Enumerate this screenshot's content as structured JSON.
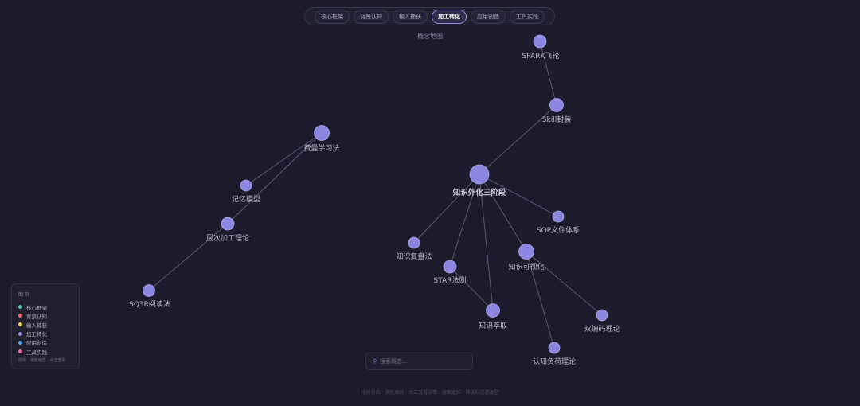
{
  "tabs": [
    {
      "label": "核心框架",
      "active": false
    },
    {
      "label": "背景认知",
      "active": false
    },
    {
      "label": "输入捕获",
      "active": false
    },
    {
      "label": "加工转化",
      "active": true
    },
    {
      "label": "应用创造",
      "active": false
    },
    {
      "label": "工具实践",
      "active": false
    }
  ],
  "page_title": "概念地图",
  "graph": {
    "node_color": "#8b86e0",
    "edge_color": "#5a5a70",
    "nodes": [
      {
        "id": "spark",
        "label": "SPARK飞轮"
      },
      {
        "id": "skill",
        "label": "Skill封装"
      },
      {
        "id": "feynman",
        "label": "费曼学习法"
      },
      {
        "id": "main",
        "label": "知识外化三阶段"
      },
      {
        "id": "memory",
        "label": "记忆模型"
      },
      {
        "id": "sop",
        "label": "SOP文件体系"
      },
      {
        "id": "levels",
        "label": "层次加工理论"
      },
      {
        "id": "review",
        "label": "知识复盘法"
      },
      {
        "id": "visual",
        "label": "知识可视化"
      },
      {
        "id": "star",
        "label": "STAR法则"
      },
      {
        "id": "sq3r",
        "label": "SQ3R阅读法"
      },
      {
        "id": "extract",
        "label": "知识萃取"
      },
      {
        "id": "dual",
        "label": "双编码理论"
      },
      {
        "id": "cognitive",
        "label": "认知负荷理论"
      }
    ],
    "edges": [
      [
        "spark",
        "skill"
      ],
      [
        "skill",
        "main"
      ],
      [
        "main",
        "sop"
      ],
      [
        "main",
        "review"
      ],
      [
        "main",
        "star"
      ],
      [
        "main",
        "extract"
      ],
      [
        "main",
        "visual"
      ],
      [
        "star",
        "extract"
      ],
      [
        "visual",
        "dual"
      ],
      [
        "visual",
        "cognitive"
      ],
      [
        "feynman",
        "memory"
      ],
      [
        "feynman",
        "levels"
      ],
      [
        "levels",
        "sq3r"
      ]
    ]
  },
  "legend": {
    "title": "图 例",
    "items": [
      {
        "label": "核心框架",
        "color": "#4ecdc4"
      },
      {
        "label": "背景认知",
        "color": "#ff6b6b"
      },
      {
        "label": "输入捕获",
        "color": "#f7d046"
      },
      {
        "label": "加工转化",
        "color": "#9d8cf0"
      },
      {
        "label": "应用创造",
        "color": "#5aa9f0"
      },
      {
        "label": "工具实践",
        "color": "#f06ba0"
      }
    ],
    "hint": "拖拽 · 滚轮缩放 · 点击查看"
  },
  "search": {
    "placeholder": "搜索概念..."
  },
  "footer": "拖拽节点 · 滚轮缩放 · 点击查看详情 · 搜索定位 · 筛选栏过滤类型"
}
